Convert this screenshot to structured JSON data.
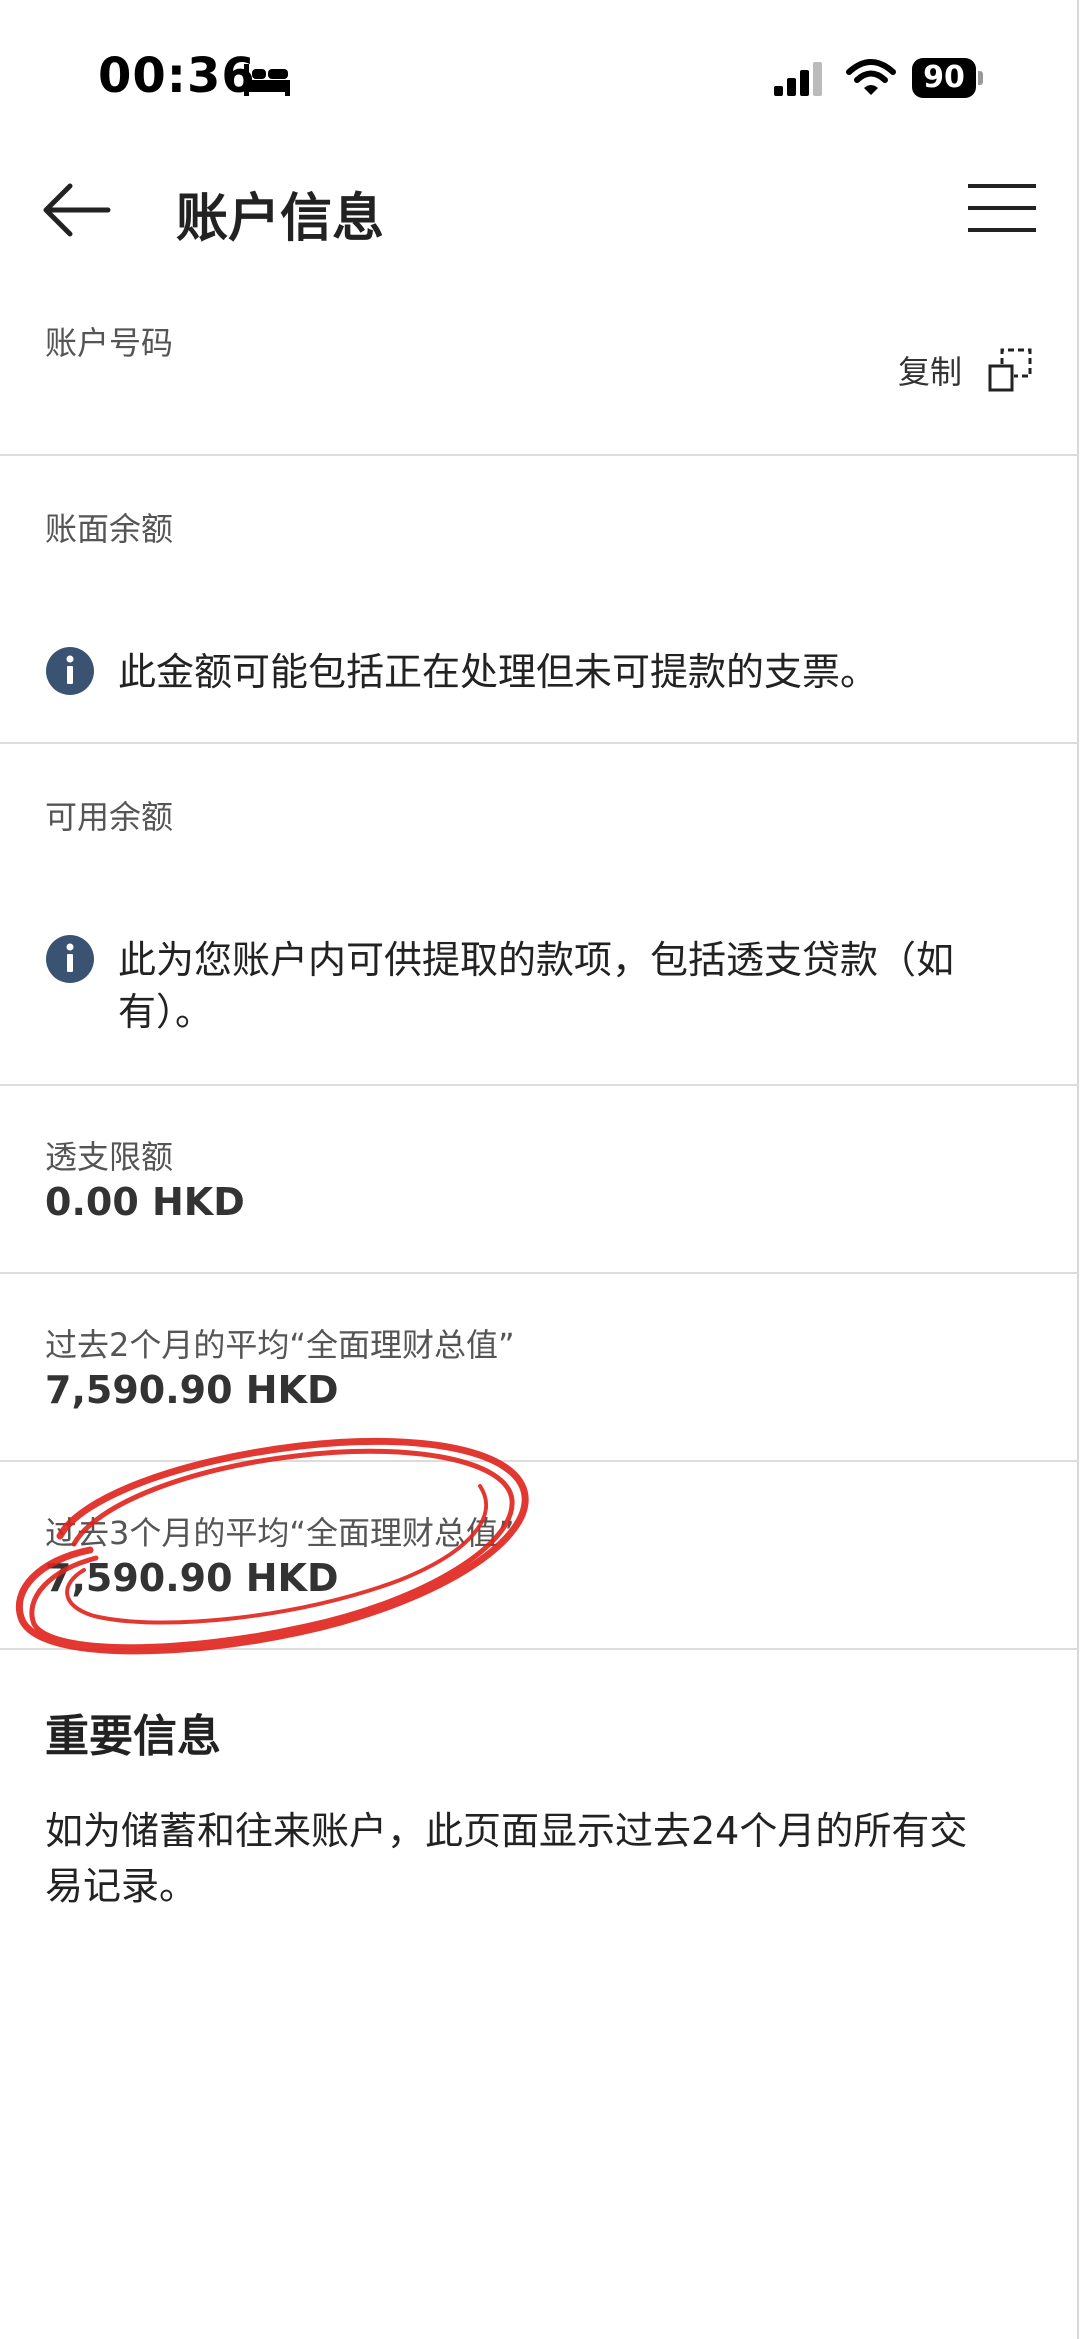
{
  "status_bar": {
    "time": "00:36",
    "battery": "90"
  },
  "header": {
    "title": "账户信息"
  },
  "account_number": {
    "label": "账户号码",
    "copy_label": "复制"
  },
  "book_balance": {
    "label": "账面余额",
    "info": "此金额可能包括正在处理但未可提款的支票。"
  },
  "available_balance": {
    "label": "可用余额",
    "info": "此为您账户内可供提取的款项，包括透支贷款（如有）。"
  },
  "overdraft": {
    "label": "透支限额",
    "value": "0.00 HKD"
  },
  "avg_2_months": {
    "label": "过去2个月的平均“全面理财总值”",
    "value": "7,590.90 HKD"
  },
  "avg_3_months": {
    "label": "过去3个月的平均“全面理财总值”",
    "value": "7,590.90 HKD"
  },
  "important": {
    "title": "重要信息",
    "text": "如为储蓄和往来账户，此页面显示过去24个月的所有交易记录。"
  },
  "colors": {
    "info_icon": "#3b5373",
    "annotation_red": "#e0231c",
    "divider": "#dcdcdc"
  }
}
